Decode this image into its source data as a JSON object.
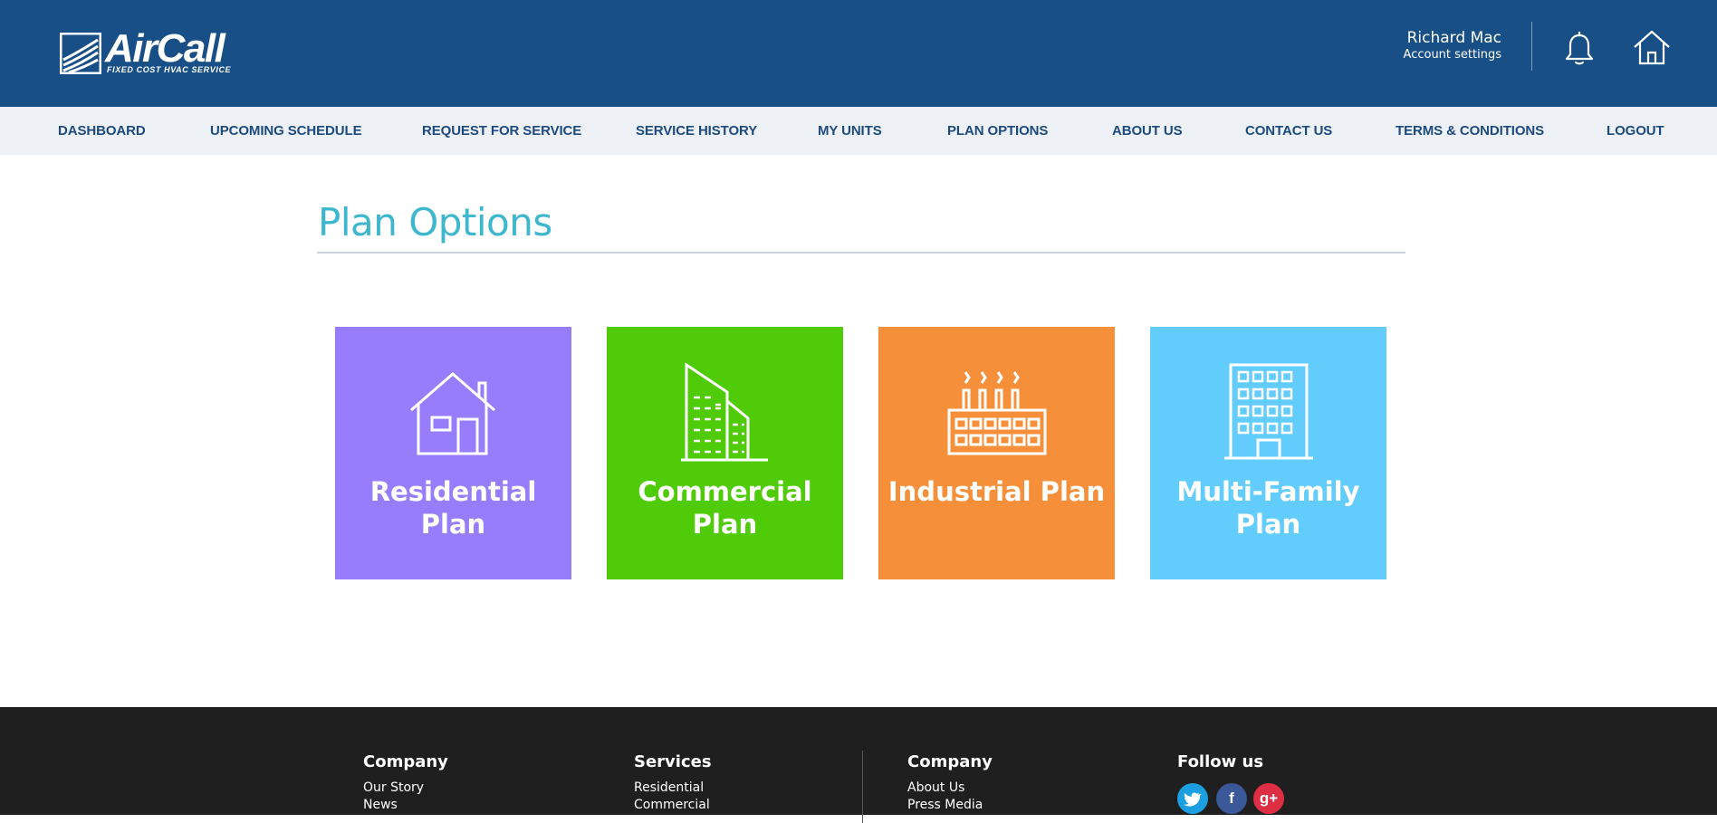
{
  "brand": {
    "name": "AirCall",
    "tagline": "FIXED COST HVAC SERVICE",
    "logo_icon": "aircall-logo-icon",
    "header_color": "#174f86"
  },
  "user": {
    "name": "Richard Mac",
    "settings_label": "Account settings"
  },
  "header_icons": [
    "bell-icon",
    "home-icon"
  ],
  "nav": {
    "items": [
      {
        "label": "DASHBOARD"
      },
      {
        "label": "UPCOMING SCHEDULE"
      },
      {
        "label": "REQUEST FOR SERVICE"
      },
      {
        "label": "SERVICE HISTORY"
      },
      {
        "label": "MY UNITS"
      },
      {
        "label": "PLAN OPTIONS"
      },
      {
        "label": "ABOUT US"
      },
      {
        "label": "CONTACT US"
      },
      {
        "label": "TERMS & CONDITIONS"
      },
      {
        "label": "LOGOUT"
      }
    ]
  },
  "page": {
    "title": "Plan Options"
  },
  "plans": [
    {
      "label": "Residential Plan",
      "icon": "house-icon",
      "color": "#977dfb"
    },
    {
      "label": "Commercial Plan",
      "icon": "office-buildings-icon",
      "color": "#50cb0a"
    },
    {
      "label": "Industrial Plan",
      "icon": "factory-icon",
      "color": "#f68f3a"
    },
    {
      "label": "Multi-Family Plan",
      "icon": "apartment-building-icon",
      "color": "#62cdfd"
    }
  ],
  "footer": {
    "columns": [
      {
        "heading": "Company",
        "links": [
          "Our Story",
          "News"
        ]
      },
      {
        "heading": "Services",
        "links": [
          "Residential",
          "Commercial"
        ]
      },
      {
        "heading": "Company",
        "links": [
          "About Us",
          "Press Media"
        ]
      },
      {
        "heading": "Follow us",
        "links": []
      }
    ],
    "social": [
      {
        "icon": "twitter-icon",
        "color": "#1b9fe0"
      },
      {
        "icon": "facebook-icon",
        "color": "#3b5999",
        "glyph": "f"
      },
      {
        "icon": "google-plus-icon",
        "color": "#dd2e44",
        "glyph": "g+"
      }
    ]
  }
}
